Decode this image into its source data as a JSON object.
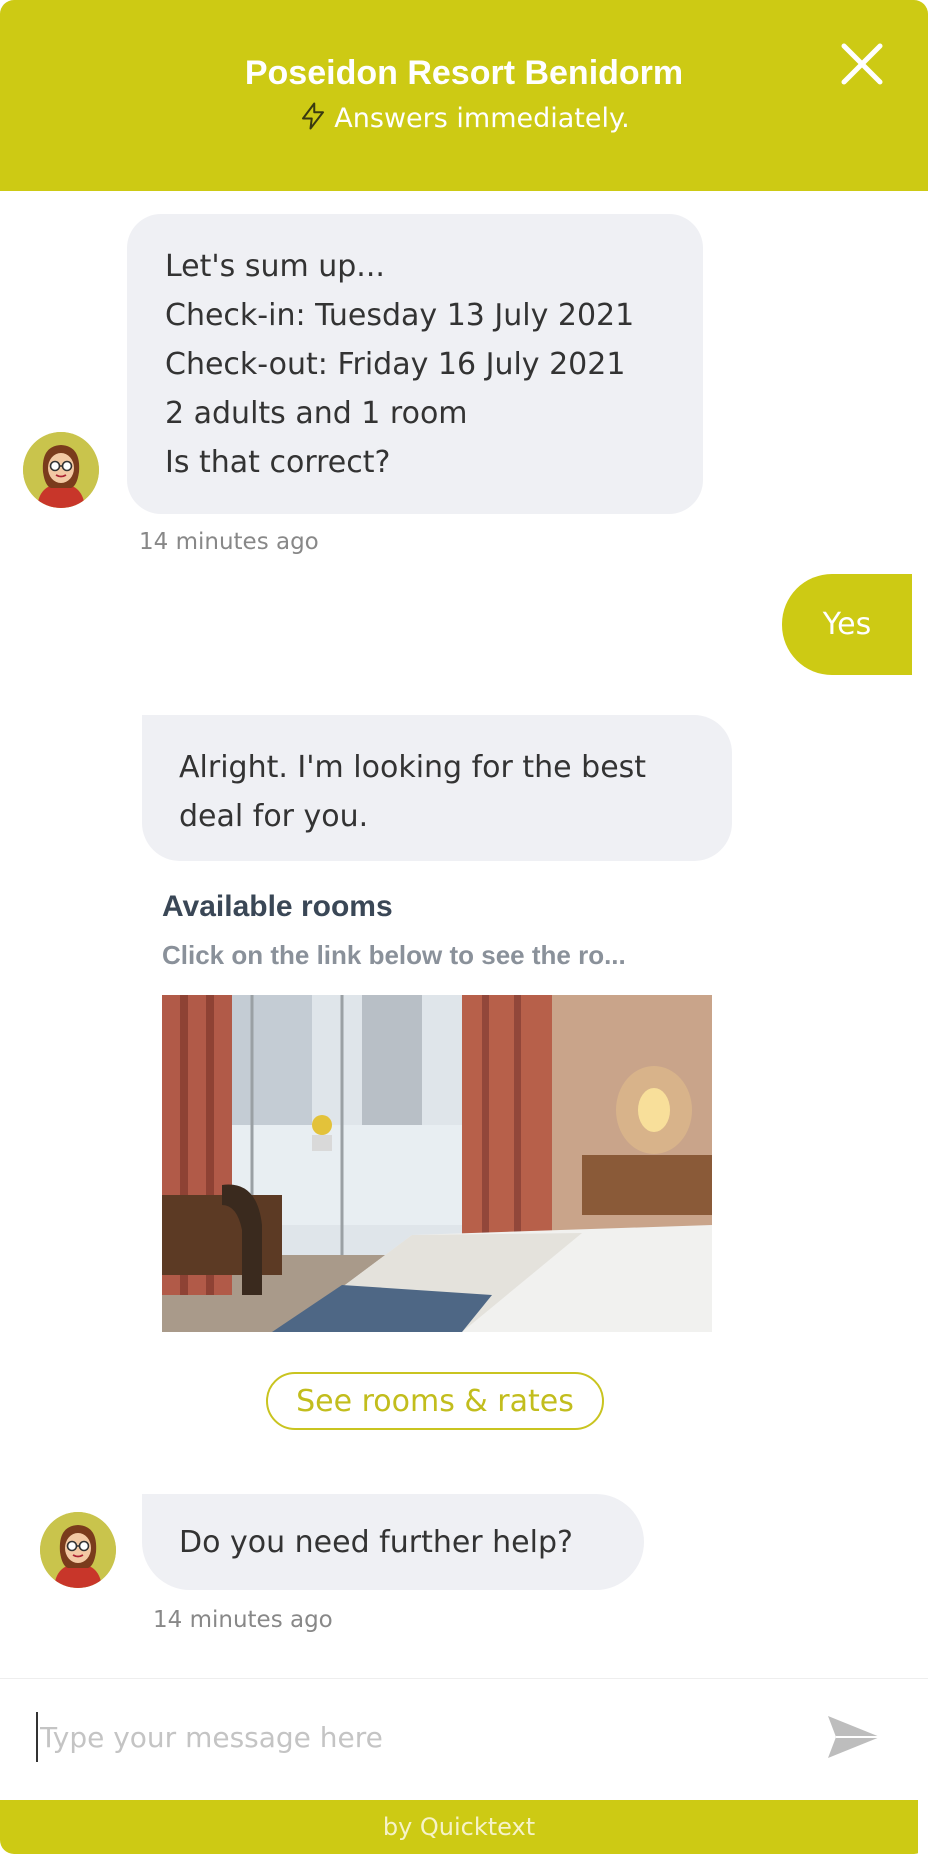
{
  "header": {
    "title": "Poseidon Resort Benidorm",
    "subtitle": "Answers immediately.",
    "bg_color": "#cdca14"
  },
  "messages": {
    "bot1": {
      "lines": [
        "Let's sum up...",
        "Check-in: Tuesday 13 July 2021",
        "Check-out: Friday 16 July 2021",
        "2 adults and 1 room",
        "Is that correct?"
      ],
      "time": "14 minutes ago"
    },
    "user1": {
      "text": "Yes"
    },
    "bot2": {
      "lines": [
        "Alright. I'm looking for the best",
        "deal for you."
      ]
    },
    "card": {
      "title": "Available rooms",
      "subtitle": "Click on the link below to see the ro...",
      "button": "See rooms & rates"
    },
    "bot3": {
      "text": "Do you need further help?",
      "time": "14 minutes ago"
    }
  },
  "input": {
    "placeholder": "Type your message here",
    "value": ""
  },
  "footer": {
    "text": "by Quicktext"
  },
  "icons": {
    "close": "close-icon",
    "bolt": "lightning-bolt-icon",
    "send": "send-icon",
    "avatar": "agent-avatar"
  }
}
